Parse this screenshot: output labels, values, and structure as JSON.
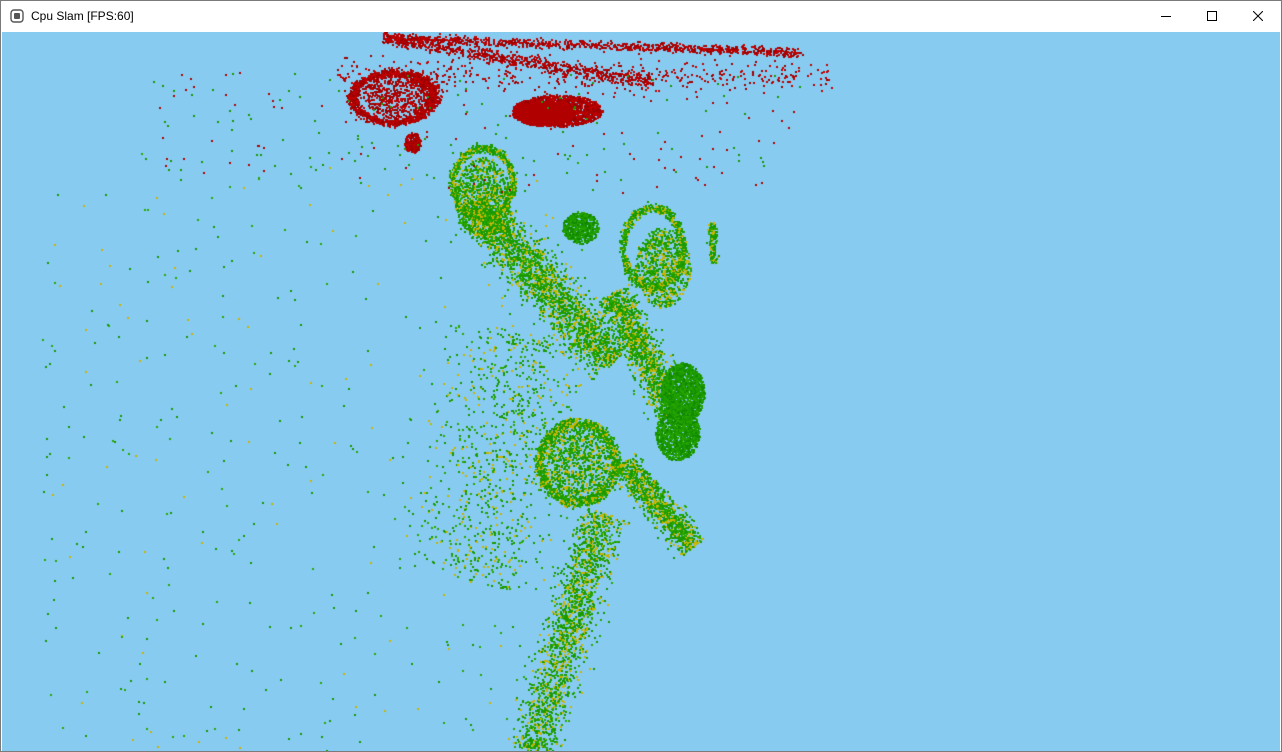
{
  "window": {
    "title": "Cpu Slam [FPS:60]",
    "icon": "app-window-icon",
    "controls": [
      {
        "name": "minimize-button",
        "icon": "minimize-icon"
      },
      {
        "name": "maximize-button",
        "icon": "maximize-icon"
      },
      {
        "name": "close-button",
        "icon": "close-icon"
      }
    ]
  },
  "viewport": {
    "background": "#87cbf0",
    "point_colors": {
      "map_points": "#b00000",
      "tracked_points": "#1a9a00",
      "candidate_points": "#c8b400"
    }
  }
}
